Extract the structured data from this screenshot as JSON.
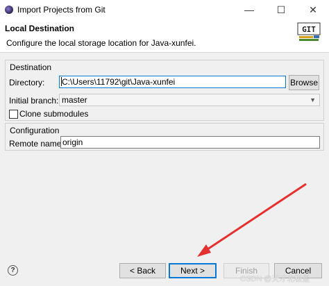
{
  "window": {
    "title": "Import Projects from Git",
    "minimize_glyph": "—",
    "maximize_glyph": "☐",
    "close_glyph": "✕"
  },
  "banner": {
    "title": "Local Destination",
    "description": "Configure the local storage location for Java-xunfei.",
    "logo_text": "GIT"
  },
  "destination": {
    "group_label": "Destination",
    "directory_label": "Directory:",
    "directory_value": "C:\\Users\\11792\\git\\Java-xunfei",
    "browse_label": "Browse",
    "branch_label": "Initial branch:",
    "branch_value": "master",
    "clone_submodules_label": "Clone submodules",
    "clone_submodules_checked": false
  },
  "configuration": {
    "group_label": "Configuration",
    "remote_label": "Remote name:",
    "remote_value": "origin"
  },
  "footer": {
    "help_glyph": "?",
    "back_label": "< Back",
    "next_label": "Next >",
    "finish_label": "Finish",
    "cancel_label": "Cancel"
  },
  "annotation": {
    "arrow_color": "#e53030"
  },
  "watermark": "CSDN @天才北极星"
}
